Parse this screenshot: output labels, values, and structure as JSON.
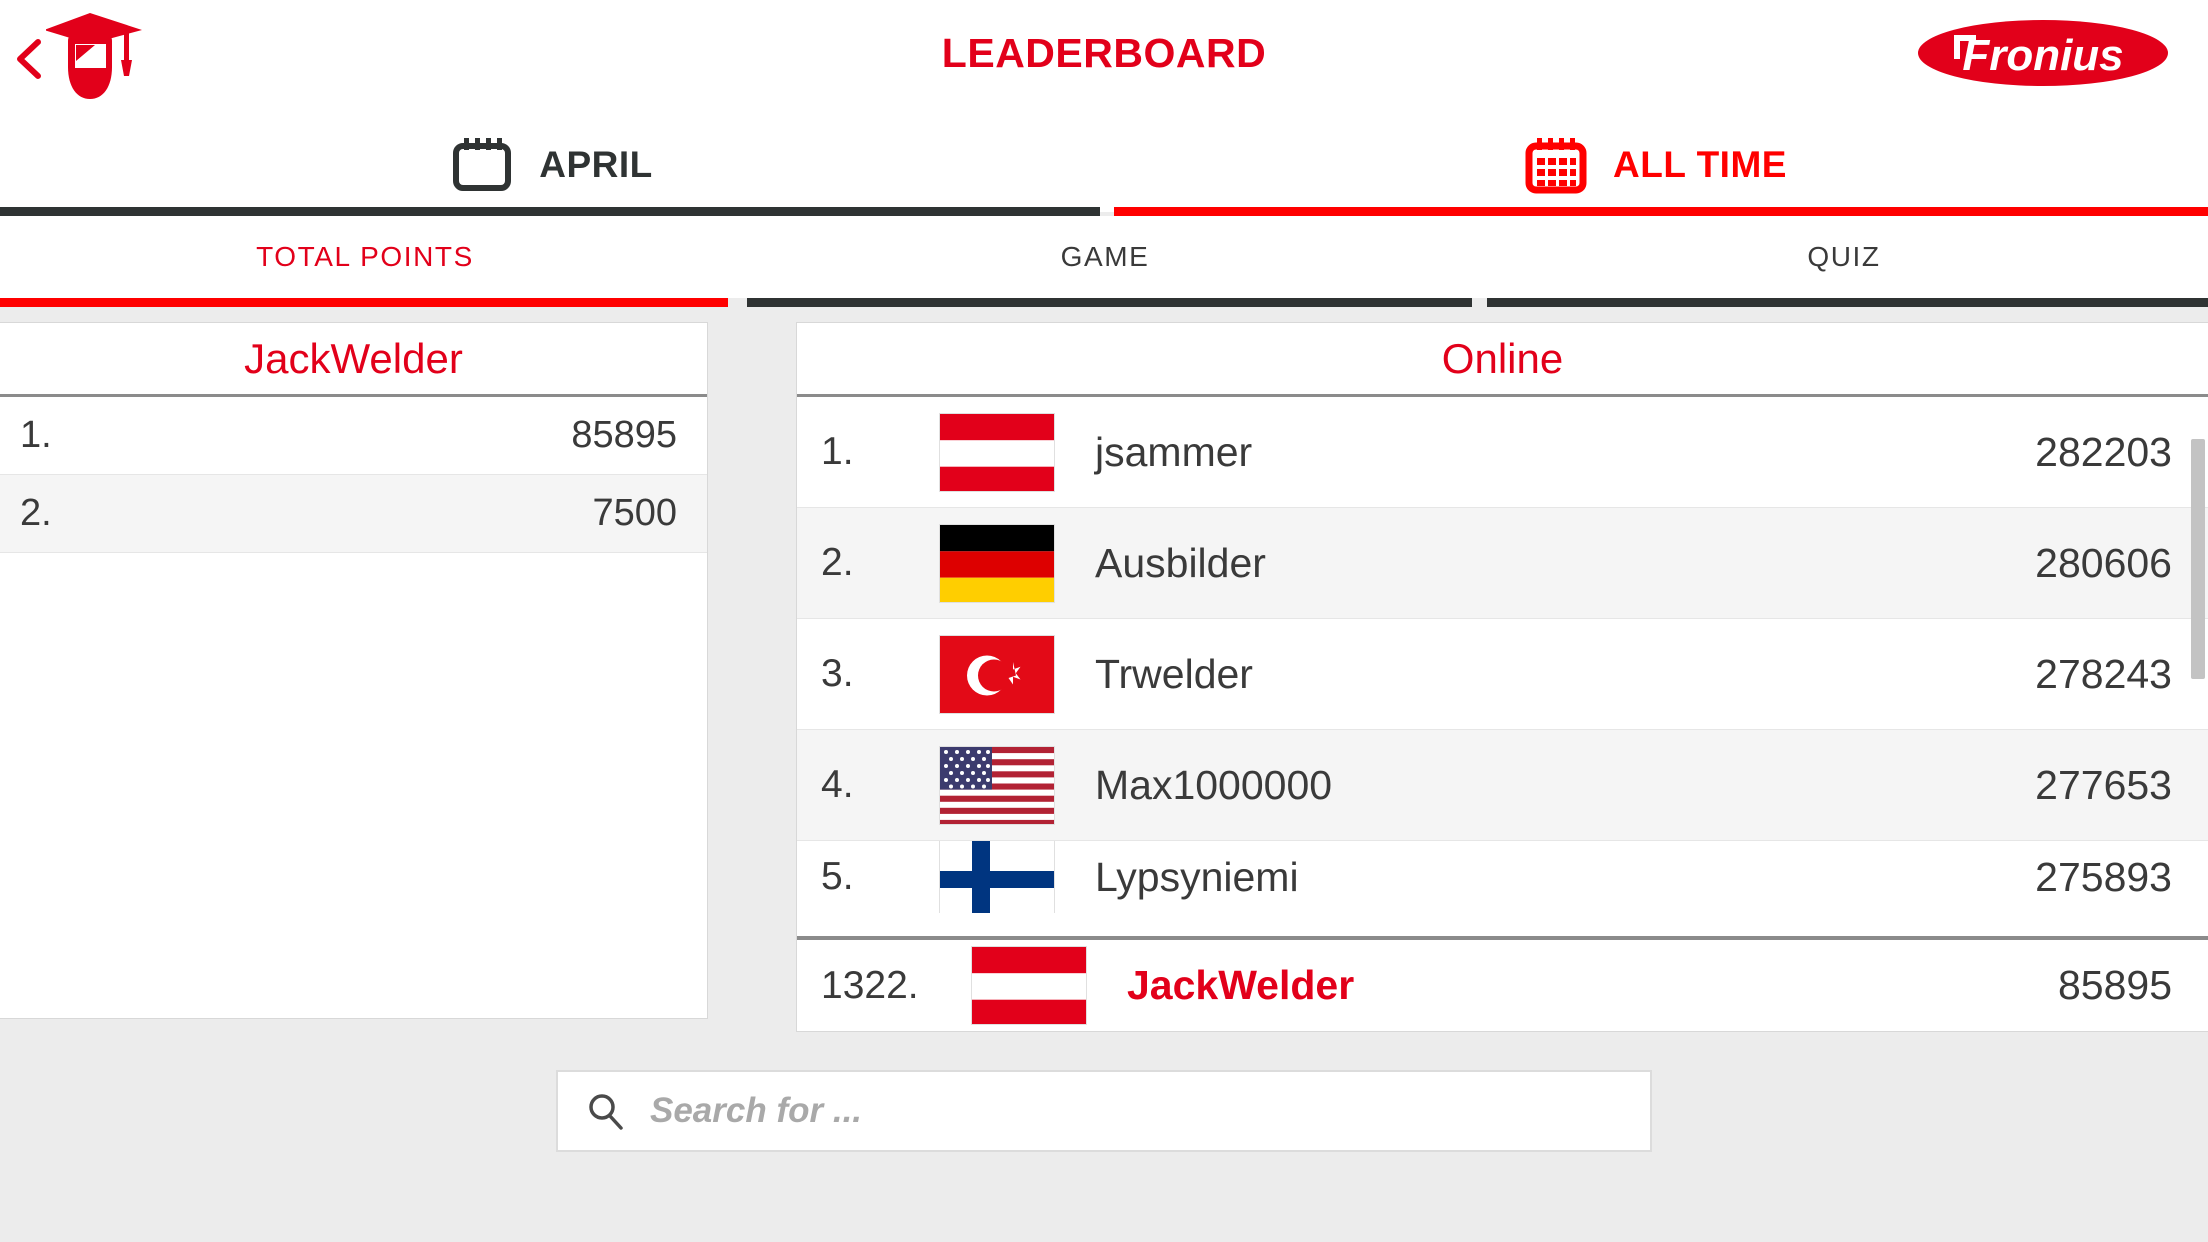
{
  "header": {
    "title": "LEADERBOARD",
    "back_icon": "chevron-left-icon",
    "app_logo_icon": "welding-helmet-graduation-cap-icon",
    "brand_logo_text": "Fronius",
    "brand_color": "#e2001a"
  },
  "period_tabs": [
    {
      "label": "APRIL",
      "icon": "calendar-blank-icon",
      "active": false,
      "color": "#2f3333"
    },
    {
      "label": "ALL TIME",
      "icon": "calendar-grid-icon",
      "active": true,
      "color": "#ff0000"
    }
  ],
  "sub_tabs": [
    {
      "label": "TOTAL POINTS",
      "active": true,
      "color": "#e2001a"
    },
    {
      "label": "GAME",
      "active": false,
      "color": "#3a3a3a"
    },
    {
      "label": "QUIZ",
      "active": false,
      "color": "#3a3a3a"
    }
  ],
  "left_panel": {
    "title": "JackWelder",
    "rows": [
      {
        "rank": "1.",
        "score": "85895"
      },
      {
        "rank": "2.",
        "score": "7500"
      }
    ]
  },
  "right_panel": {
    "title": "Online",
    "rows": [
      {
        "rank": "1.",
        "flag": "austria-flag-icon",
        "name": "jsammer",
        "score": "282203"
      },
      {
        "rank": "2.",
        "flag": "germany-flag-icon",
        "name": "Ausbilder",
        "score": "280606"
      },
      {
        "rank": "3.",
        "flag": "turkey-flag-icon",
        "name": "Trwelder",
        "score": "278243"
      },
      {
        "rank": "4.",
        "flag": "usa-flag-icon",
        "name": "Max1000000",
        "score": "277653"
      },
      {
        "rank": "5.",
        "flag": "finland-flag-icon",
        "name": "Lypsyniemi",
        "score": "275893"
      }
    ],
    "pinned_row": {
      "rank": "1322.",
      "flag": "austria-flag-icon",
      "name": "JackWelder",
      "score": "85895"
    }
  },
  "search": {
    "placeholder": "Search for ...",
    "value": "",
    "icon": "search-icon"
  }
}
